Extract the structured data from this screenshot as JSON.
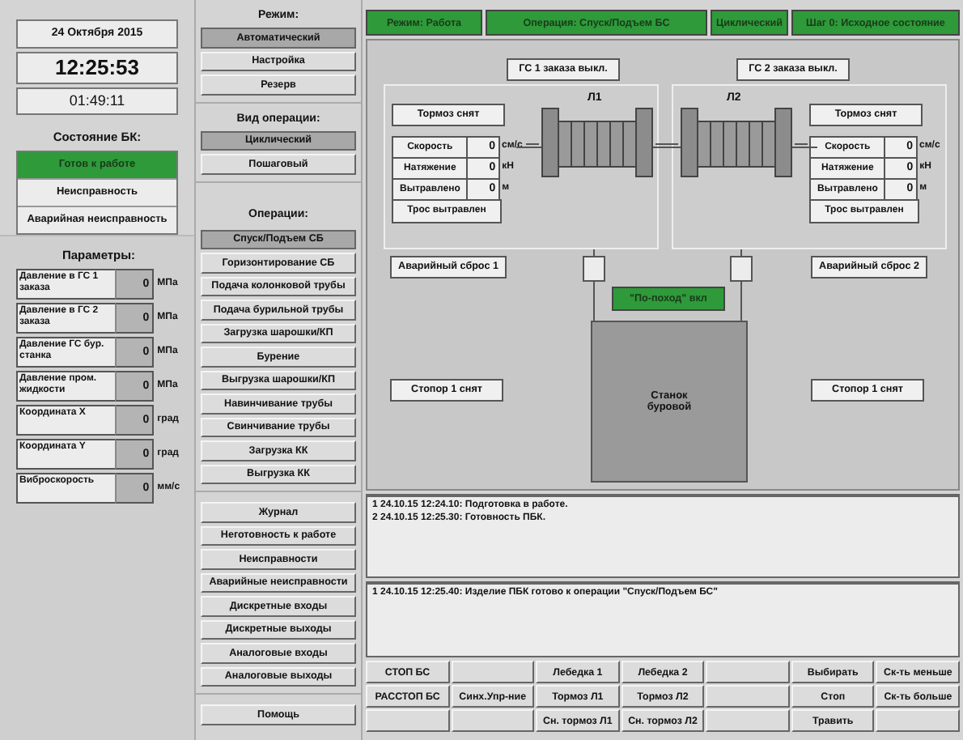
{
  "clock": {
    "date": "24 Октября 2015",
    "time": "12:25:53",
    "timer": "01:49:11"
  },
  "state": {
    "title": "Состояние БК:",
    "items": [
      {
        "label": "Готов к работе",
        "selected": true
      },
      {
        "label": "Неисправность",
        "selected": false
      },
      {
        "label": "Аварийная неисправность",
        "selected": false
      }
    ]
  },
  "params": {
    "title": "Параметры:",
    "items": [
      {
        "label": "Давление в ГС 1 заказа",
        "value": "0",
        "unit": "МПа"
      },
      {
        "label": "Давление в ГС 2 заказа",
        "value": "0",
        "unit": "МПа"
      },
      {
        "label": "Давление ГС бур. станка",
        "value": "0",
        "unit": "МПа"
      },
      {
        "label": "Давление пром. жидкости",
        "value": "0",
        "unit": "МПа"
      },
      {
        "label": "Координата X",
        "value": "0",
        "unit": "град"
      },
      {
        "label": "Координата Y",
        "value": "0",
        "unit": "град"
      },
      {
        "label": "Виброскорость",
        "value": "0",
        "unit": "мм/с"
      }
    ]
  },
  "mode": {
    "title": "Режим:",
    "items": [
      {
        "label": "Автоматический",
        "selected": true
      },
      {
        "label": "Настройка",
        "selected": false
      },
      {
        "label": "Резерв",
        "selected": false
      }
    ]
  },
  "op_type": {
    "title": "Вид операции:",
    "items": [
      {
        "label": "Циклический",
        "selected": true
      },
      {
        "label": "Пошаговый",
        "selected": false
      }
    ]
  },
  "operations": {
    "title": "Операции:",
    "items": [
      {
        "label": "Спуск/Подъем СБ",
        "selected": true
      },
      {
        "label": "Горизонтирование СБ",
        "selected": false
      },
      {
        "label": "Подача колонковой трубы",
        "selected": false
      },
      {
        "label": "Подача бурильной трубы",
        "selected": false
      },
      {
        "label": "Загрузка шарошки/КП",
        "selected": false
      },
      {
        "label": "Бурение",
        "selected": false
      },
      {
        "label": "Выгрузка шарошки/КП",
        "selected": false
      },
      {
        "label": "Навинчивание трубы",
        "selected": false
      },
      {
        "label": "Свинчивание трубы",
        "selected": false
      },
      {
        "label": "Загрузка КК",
        "selected": false
      },
      {
        "label": "Выгрузка КК",
        "selected": false
      }
    ]
  },
  "menu": [
    "Журнал",
    "Неготовность к работе",
    "Неисправности",
    "Аварийные неисправности",
    "Дискретные входы",
    "Дискретные выходы",
    "Аналоговые входы",
    "Аналоговые выходы"
  ],
  "help": "Помощь",
  "status_bar": [
    "Режим: Работа",
    "Операция: Спуск/Подъем БС",
    "Циклический",
    "Шаг 0: Исходное состояние"
  ],
  "diagram": {
    "pump_labels": [
      "ГС 1 заказа выкл.",
      "ГС 2 заказа выкл."
    ],
    "winches": [
      {
        "name": "Л1",
        "brake": "Тормоз снят",
        "rows": [
          {
            "label": "Скорость",
            "value": "0",
            "unit": "см/с"
          },
          {
            "label": "Натяжение",
            "value": "0",
            "unit": "кН"
          },
          {
            "label": "Вытравлено",
            "value": "0",
            "unit": "м"
          }
        ],
        "rope": "Трос вытравлен"
      },
      {
        "name": "Л2",
        "brake": "Тормоз снят",
        "rows": [
          {
            "label": "Скорость",
            "value": "0",
            "unit": "см/с"
          },
          {
            "label": "Натяжение",
            "value": "0",
            "unit": "кН"
          },
          {
            "label": "Вытравлено",
            "value": "0",
            "unit": "м"
          }
        ],
        "rope": "Трос вытравлен"
      }
    ],
    "emergency": [
      "Аварийный сброс 1",
      "Аварийный сброс 2"
    ],
    "stoppers": [
      "Стопор 1 снят",
      "Стопор 1 снят"
    ],
    "travel": "\"По-поход\" вкл",
    "machine": "Станок буровой"
  },
  "logs": [
    [
      "1 24.10.15 12:24.10: Подготовка в работе.",
      "2 24.10.15 12:25.30: Готовность ПБК."
    ],
    [
      "1 24.10.15 12:25.40: Изделие ПБК готово к операции \"Спуск/Подъем БС\""
    ]
  ],
  "controls": [
    [
      {
        "kind": "button",
        "label": "СТОП БС"
      },
      {
        "kind": "blank"
      },
      {
        "kind": "button",
        "label": "Лебедка 1"
      },
      {
        "kind": "button",
        "label": "Лебедка 2"
      },
      {
        "kind": "blank"
      },
      {
        "kind": "button",
        "label": "Выбирать"
      },
      {
        "kind": "button",
        "label": "Ск-ть меньше"
      }
    ],
    [
      {
        "kind": "button",
        "label": "РАССТОП БС"
      },
      {
        "kind": "button",
        "label": "Синх.Упр-ние"
      },
      {
        "kind": "button",
        "label": "Тормоз Л1"
      },
      {
        "kind": "button",
        "label": "Тормоз Л2"
      },
      {
        "kind": "blank"
      },
      {
        "kind": "button",
        "label": "Стоп"
      },
      {
        "kind": "button",
        "label": "Ск-ть больше"
      }
    ],
    [
      {
        "kind": "blank"
      },
      {
        "kind": "blank"
      },
      {
        "kind": "button",
        "label": "Сн. тормоз Л1"
      },
      {
        "kind": "button",
        "label": "Сн. тормоз Л2"
      },
      {
        "kind": "blank"
      },
      {
        "kind": "button",
        "label": "Травить"
      },
      {
        "kind": "blank"
      }
    ]
  ]
}
